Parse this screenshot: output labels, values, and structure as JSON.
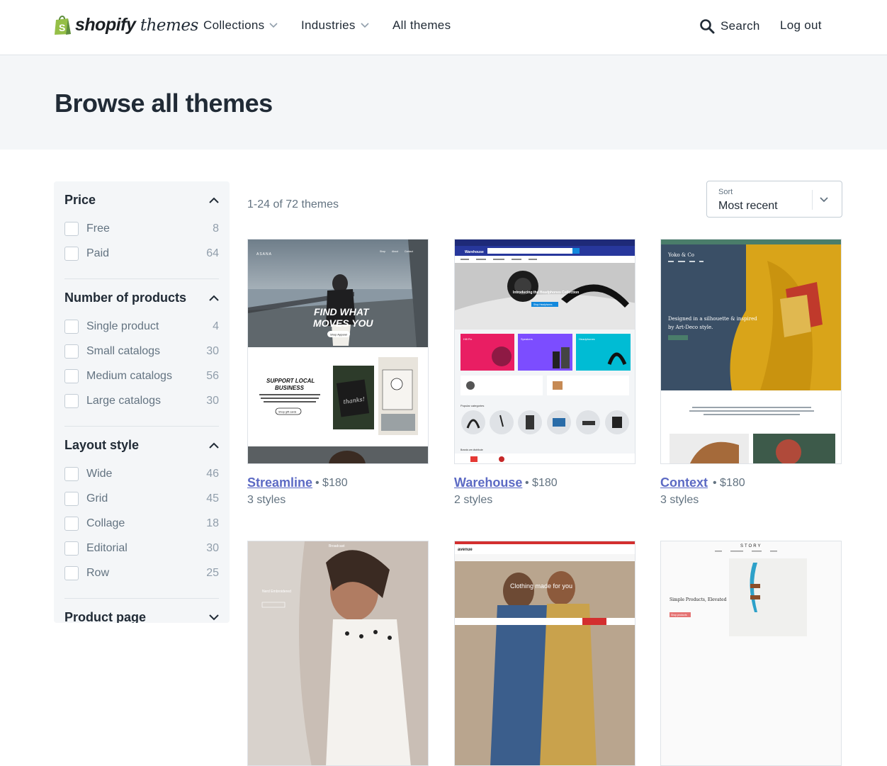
{
  "header": {
    "logo_bold": "shopify",
    "logo_light": "themes",
    "nav": [
      {
        "label": "Collections"
      },
      {
        "label": "Industries"
      },
      {
        "label": "All themes"
      }
    ],
    "search_label": "Search",
    "logout_label": "Log out"
  },
  "page_title": "Browse all themes",
  "filters": {
    "price": {
      "title": "Price",
      "options": [
        {
          "label": "Free",
          "count": "8"
        },
        {
          "label": "Paid",
          "count": "64"
        }
      ]
    },
    "products": {
      "title": "Number of products",
      "options": [
        {
          "label": "Single product",
          "count": "4"
        },
        {
          "label": "Small catalogs",
          "count": "30"
        },
        {
          "label": "Medium catalogs",
          "count": "56"
        },
        {
          "label": "Large catalogs",
          "count": "30"
        }
      ]
    },
    "layout": {
      "title": "Layout style",
      "options": [
        {
          "label": "Wide",
          "count": "46"
        },
        {
          "label": "Grid",
          "count": "45"
        },
        {
          "label": "Collage",
          "count": "18"
        },
        {
          "label": "Editorial",
          "count": "30"
        },
        {
          "label": "Row",
          "count": "25"
        }
      ]
    },
    "product_page": {
      "title": "Product page"
    }
  },
  "results": {
    "count_text": "1-24 of 72 themes"
  },
  "sort": {
    "label": "Sort",
    "value": "Most recent"
  },
  "themes": [
    {
      "name": "Streamline",
      "price": "$180",
      "styles": "3 styles"
    },
    {
      "name": "Warehouse",
      "price": "$180",
      "styles": "2 styles"
    },
    {
      "name": "Context",
      "price": "$180",
      "styles": "3 styles"
    }
  ],
  "previews": {
    "streamline": {
      "brand": "ASANA",
      "headline1": "FIND WHAT",
      "headline2": "MOVES YOU",
      "cta": "Shop Apparel",
      "section1": "SUPPORT LOCAL",
      "section2": "BUSINESS",
      "cta2": "Shop gift cards"
    },
    "warehouse": {
      "brand": "Warehouse",
      "hero": "Introducing the Headphones Collection",
      "cta": "Shop Headphones",
      "tile1": "Hifi Fix",
      "tile2": "Speakers",
      "tile3": "Headphones",
      "popular": "Popular categories",
      "brands": "Brands we distribute"
    },
    "context": {
      "brand": "Yoko & Co",
      "headline1": "Designed in a silhouette & inspired",
      "headline2": "by Art-Deco style."
    },
    "broadcast": {
      "brand": "Broadcast",
      "headline": "Nerd Embroidered"
    },
    "avenue": {
      "brand": "avenue",
      "headline": "Clothing made for you"
    },
    "story": {
      "brand": "STORY",
      "headline": "Simple Products, Elevated",
      "cta": "Shop products"
    }
  },
  "colors": {
    "accent": "#5c6ac4",
    "shopify_green": "#95bf47",
    "text": "#212b36",
    "muted": "#637381"
  }
}
